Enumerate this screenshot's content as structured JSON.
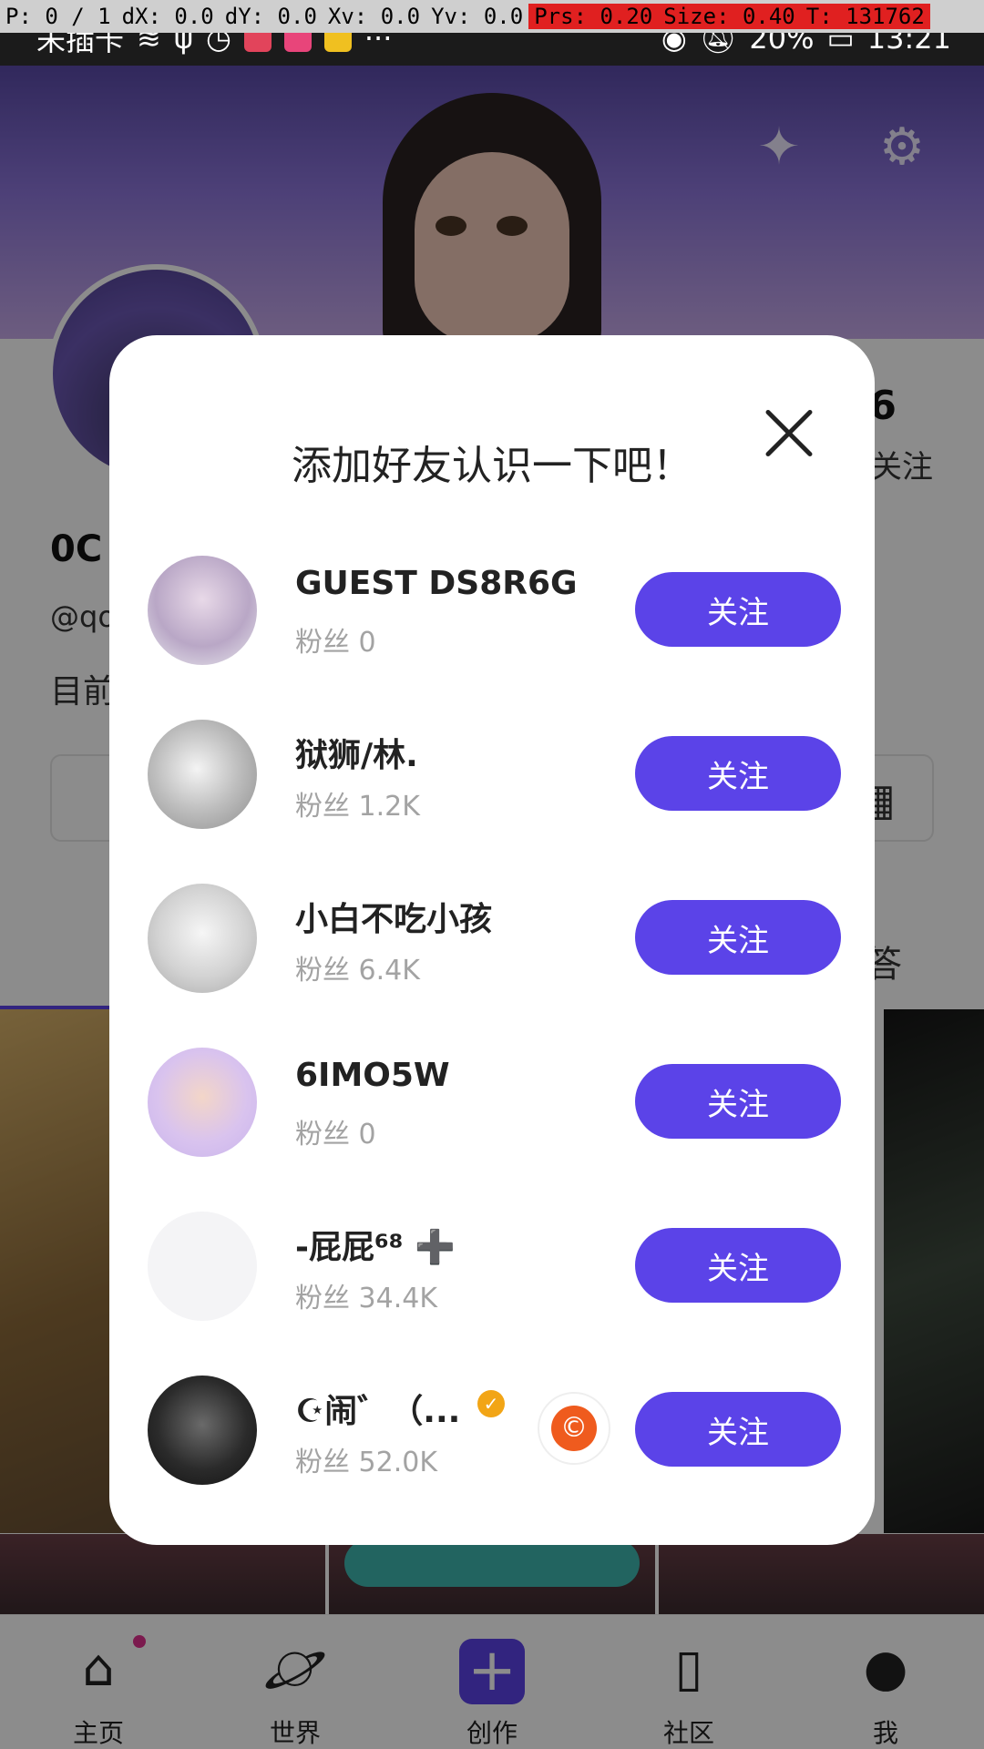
{
  "debug_overlay": {
    "pointer": "P: 0 / 1",
    "dx": "dX: 0.0",
    "dy": "dY: 0.0",
    "xv": "Xv: 0.0",
    "yv": "Yv: 0.0",
    "prs": "Prs: 0.20",
    "size": "Size: 0.40",
    "touch": "T: 131762"
  },
  "status_bar": {
    "carrier": "未插卡",
    "battery": "20%",
    "time": "13:21"
  },
  "profile": {
    "name_partial": "0C",
    "id_partial": "@qo",
    "bio_partial": "目前",
    "count_partial": "6",
    "count_label": "关注",
    "tab_partial": "答"
  },
  "modal": {
    "title": "添加好友认识一下吧！",
    "follow_label": "关注",
    "users": [
      {
        "name": "GUEST DS8R6G",
        "fans": "粉丝 0"
      },
      {
        "name": "狱狮/林.",
        "fans": "粉丝 1.2K"
      },
      {
        "name": "小白不吃小孩",
        "fans": "粉丝 6.4K"
      },
      {
        "name": "6IMO5W",
        "fans": "粉丝 0"
      },
      {
        "name": "-屁屁⁶⁸ ➕",
        "fans": "粉丝 34.4K"
      },
      {
        "name": "☪闹゛（...",
        "fans": "粉丝 52.0K"
      }
    ]
  },
  "bottom_nav": {
    "items": [
      {
        "label": "主页"
      },
      {
        "label": "世界"
      },
      {
        "label": "创作"
      },
      {
        "label": "社区"
      },
      {
        "label": "我"
      }
    ]
  },
  "colors": {
    "accent": "#5b43e8",
    "verified": "#f2a516",
    "copyright": "#ef5b1e"
  }
}
